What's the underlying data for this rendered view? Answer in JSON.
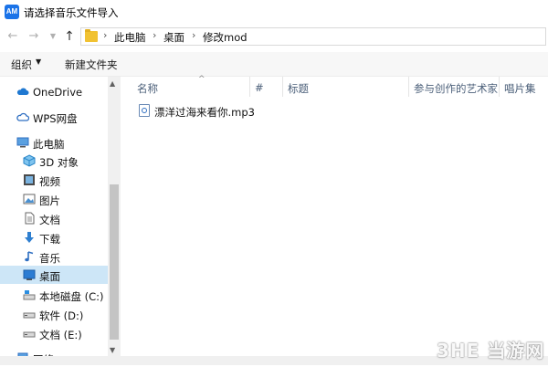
{
  "window": {
    "app_icon_text": "AM",
    "title": "请选择音乐文件导入"
  },
  "address": {
    "breadcrumbs": [
      "此电脑",
      "桌面",
      "修改mod"
    ],
    "separator": "›"
  },
  "toolbar": {
    "organize_label": "组织",
    "new_folder_label": "新建文件夹"
  },
  "nav": {
    "items": [
      {
        "label": "OneDrive",
        "icon": "onedrive-icon"
      },
      {
        "label": "WPS网盘",
        "icon": "cloud-icon"
      },
      {
        "label": "此电脑",
        "icon": "computer-icon"
      },
      {
        "label": "3D 对象",
        "icon": "3d-objects-icon"
      },
      {
        "label": "视频",
        "icon": "video-icon"
      },
      {
        "label": "图片",
        "icon": "pictures-icon"
      },
      {
        "label": "文档",
        "icon": "documents-icon"
      },
      {
        "label": "下载",
        "icon": "download-icon"
      },
      {
        "label": "音乐",
        "icon": "music-icon"
      },
      {
        "label": "桌面",
        "icon": "desktop-icon",
        "selected": true
      },
      {
        "label": "本地磁盘 (C:)",
        "icon": "drive-c-icon"
      },
      {
        "label": "软件 (D:)",
        "icon": "drive-icon"
      },
      {
        "label": "文档 (E:)",
        "icon": "drive-icon"
      },
      {
        "label": "网络",
        "icon": "network-icon"
      }
    ]
  },
  "columns": [
    "名称",
    "#",
    "标题",
    "参与创作的艺术家",
    "唱片集"
  ],
  "files": [
    {
      "name": "漂洋过海来看你.mp3",
      "icon": "audio-file-icon"
    }
  ],
  "watermark": "3HE 当游网"
}
